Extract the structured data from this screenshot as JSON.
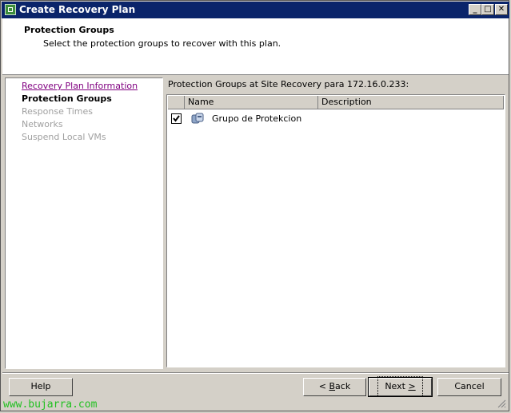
{
  "window": {
    "title": "Create Recovery Plan",
    "controls": {
      "minimize": "_",
      "maximize": "□",
      "close": "✕"
    }
  },
  "header": {
    "title": "Protection Groups",
    "subtitle": "Select the protection groups to recover with this plan."
  },
  "steps": [
    {
      "label": "Recovery Plan Information",
      "state": "link"
    },
    {
      "label": "Protection Groups",
      "state": "current"
    },
    {
      "label": "Response Times",
      "state": "disabled"
    },
    {
      "label": "Networks",
      "state": "disabled"
    },
    {
      "label": "Suspend Local VMs",
      "state": "disabled"
    }
  ],
  "main": {
    "list_label": "Protection Groups at Site Recovery para 172.16.0.233:",
    "columns": [
      "Name",
      "Description"
    ],
    "rows": [
      {
        "checked": true,
        "icon": "protection-group-icon",
        "name": "Grupo de Protekcion",
        "description": ""
      }
    ]
  },
  "buttons": {
    "help": "Help",
    "back_mnemonic": "B",
    "back_rest": "ack",
    "back_prefix": "< ",
    "next_main": "Next ",
    "next_mnemonic": ">",
    "cancel": "Cancel"
  },
  "watermark": "www.bujarra.com",
  "colors": {
    "titlebar": "#0a246a",
    "link_visited": "#800080",
    "disabled_text": "#a0a0a0",
    "watermark": "#20c020"
  }
}
